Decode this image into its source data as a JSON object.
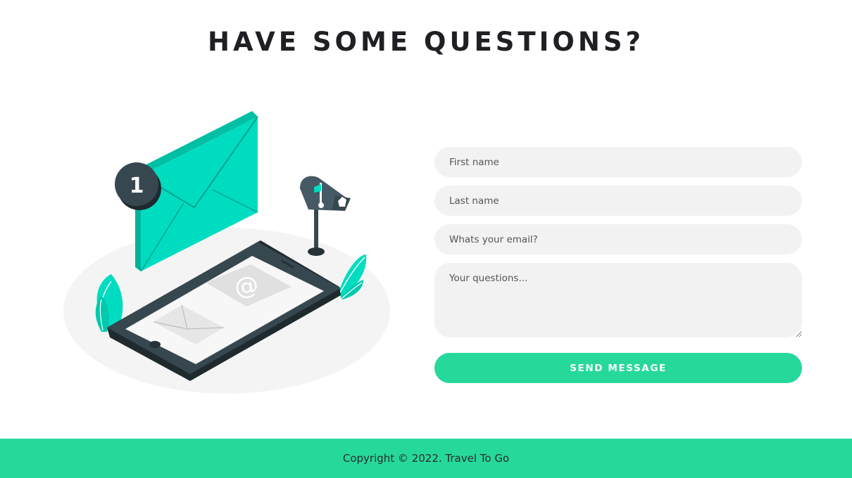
{
  "heading": "HAVE SOME QUESTIONS?",
  "illustration": {
    "badge_number": "1",
    "at_symbol": "@"
  },
  "form": {
    "first_name_placeholder": "First name",
    "last_name_placeholder": "Last name",
    "email_placeholder": "Whats your email?",
    "questions_placeholder": "Your questions...",
    "submit_label": "SEND MESSAGE"
  },
  "footer": {
    "copyright": "Copyright © 2022. Travel To Go"
  },
  "colors": {
    "accent": "#26d99b",
    "envelope": "#00dcc0",
    "dark": "#263238",
    "field_bg": "#f2f2f2"
  }
}
